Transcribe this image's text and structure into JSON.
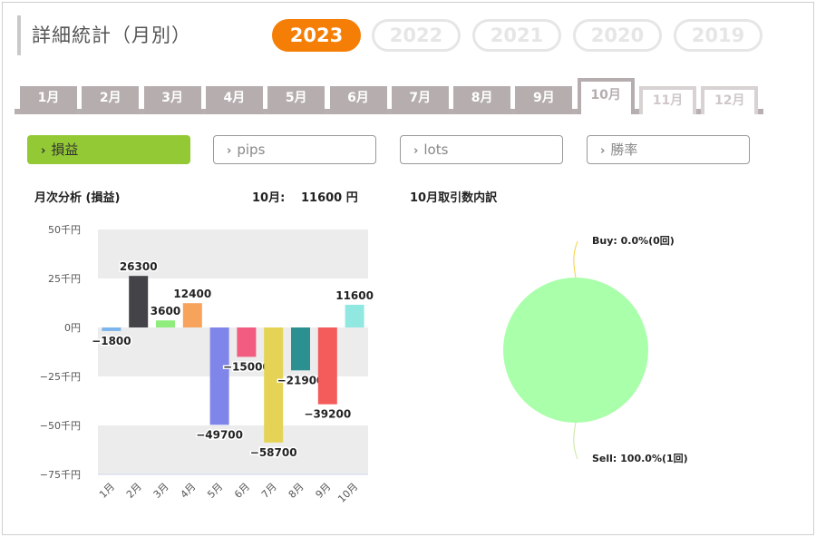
{
  "page": {
    "title": "詳細統計（月別）"
  },
  "years": [
    {
      "label": "2023",
      "active": true
    },
    {
      "label": "2022",
      "active": false
    },
    {
      "label": "2021",
      "active": false
    },
    {
      "label": "2020",
      "active": false
    },
    {
      "label": "2019",
      "active": false
    }
  ],
  "months": [
    {
      "label": "1月",
      "state": "normal"
    },
    {
      "label": "2月",
      "state": "normal"
    },
    {
      "label": "3月",
      "state": "normal"
    },
    {
      "label": "4月",
      "state": "normal"
    },
    {
      "label": "5月",
      "state": "normal"
    },
    {
      "label": "6月",
      "state": "normal"
    },
    {
      "label": "7月",
      "state": "normal"
    },
    {
      "label": "8月",
      "state": "normal"
    },
    {
      "label": "9月",
      "state": "normal"
    },
    {
      "label": "10月",
      "state": "active"
    },
    {
      "label": "11月",
      "state": "future"
    },
    {
      "label": "12月",
      "state": "future"
    }
  ],
  "metrics": [
    {
      "label": "損益",
      "active": true
    },
    {
      "label": "pips",
      "active": false
    },
    {
      "label": "lots",
      "active": false
    },
    {
      "label": "勝率",
      "active": false
    }
  ],
  "summary": {
    "bar_title": "月次分析 (損益)",
    "month_label": "10月:",
    "month_value": "11600 円",
    "pie_title": "10月取引数内訳"
  },
  "icons": {
    "chevron": "chevron-right-icon"
  },
  "chart_data": [
    {
      "type": "bar",
      "title": "月次分析 (損益)",
      "categories": [
        "1月",
        "2月",
        "3月",
        "4月",
        "5月",
        "6月",
        "7月",
        "8月",
        "9月",
        "10月"
      ],
      "values": [
        -1800,
        26300,
        3600,
        12400,
        -49700,
        -15000,
        -58700,
        -21900,
        -39200,
        11600
      ],
      "colors": [
        "#7cb5ec",
        "#434348",
        "#90ed7d",
        "#f7a35c",
        "#8085e9",
        "#f15c80",
        "#e4d354",
        "#2b908f",
        "#f45b5b",
        "#91e8e1"
      ],
      "ylim": [
        -75000,
        50000
      ],
      "yticks": [
        {
          "value": 50000,
          "label": "50千円"
        },
        {
          "value": 25000,
          "label": "25千円"
        },
        {
          "value": 0,
          "label": "0円"
        },
        {
          "value": -25000,
          "label": "−25千円"
        },
        {
          "value": -50000,
          "label": "−50千円"
        },
        {
          "value": -75000,
          "label": "−75千円"
        }
      ],
      "grid": "alternating-bands",
      "xlabel": "",
      "ylabel": ""
    },
    {
      "type": "pie",
      "title": "10月取引数内訳",
      "slices": [
        {
          "name": "Buy",
          "value": 0,
          "label": "Buy: 0.0%(0回)",
          "color": "#f4d03f"
        },
        {
          "name": "Sell",
          "value": 1,
          "label": "Sell: 100.0%(1回)",
          "color": "#aaffaa"
        }
      ],
      "legend": "none"
    }
  ]
}
